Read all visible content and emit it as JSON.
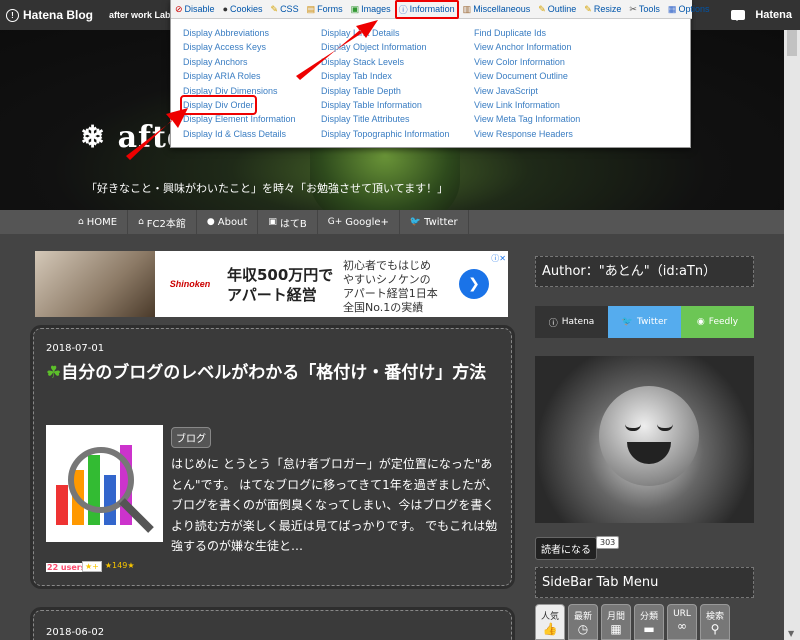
{
  "hatena_bar": {
    "logo": "Hatena Blog",
    "blog_name": "after work Labo",
    "right_logo": "Hatena"
  },
  "header": {
    "title": "after",
    "description": "「好きなこと・興味がわいたこと」を時々「お勉強させて頂いてます！」"
  },
  "nav": {
    "items": [
      {
        "icon": "home-icon",
        "label": "HOME"
      },
      {
        "icon": "bank-icon",
        "label": "FC2本館"
      },
      {
        "icon": "person-icon",
        "label": "About"
      },
      {
        "icon": "hatena-icon",
        "label": "はてB"
      },
      {
        "icon": "google-plus-icon",
        "label": "Google+"
      },
      {
        "icon": "twitter-icon",
        "label": "Twitter"
      }
    ]
  },
  "ad": {
    "logo": "Shinoken",
    "headline_line1": "年収500万円で",
    "headline_line2": "アパート経営",
    "text_line1": "初心者でもはじめ",
    "text_line2": "やすいシノケンの",
    "text_line3": "アパート経営1日本",
    "text_line4": "全国No.1の実績"
  },
  "post": {
    "date": "2018-07-01",
    "title": "自分のブログのレベルがわかる「格付け・番付け」方法",
    "category": "ブログ",
    "excerpt": "はじめに とうとう「怠け者ブロガー」が定位置になった\"あとん\"です。 はてなブログに移ってきて1年を過ぎましたが、 ブログを書くのが面倒臭くなってしまい、今はブログを書くより読む方が楽しく最近は見てばっかりです。 でもこれは勉強するのが嫌な生徒と…",
    "users": "22 users",
    "star_add": "★+",
    "stars": "★149★"
  },
  "post2": {
    "date": "2018-06-02"
  },
  "sidebar": {
    "author_title": "Author：\"あとん\"（id:aTn）",
    "share": [
      {
        "label": "Hatena",
        "color": "#333333"
      },
      {
        "label": "Twitter",
        "color": "#55acee"
      },
      {
        "label": "Feedly",
        "color": "#6cc655"
      }
    ],
    "reader_button": "読者になる",
    "reader_count": "303",
    "tab_menu_title": "SideBar Tab Menu",
    "tabs": [
      {
        "label": "人気",
        "icon": "thumbs-up-icon"
      },
      {
        "label": "最新",
        "icon": "clock-icon"
      },
      {
        "label": "月間",
        "icon": "calendar-icon"
      },
      {
        "label": "分類",
        "icon": "folder-icon"
      },
      {
        "label": "URL",
        "icon": "link-icon"
      },
      {
        "label": "検索",
        "icon": "search-icon"
      }
    ]
  },
  "toolbar": {
    "tabs": [
      {
        "label": "Disable",
        "icon": "disable-icon"
      },
      {
        "label": "Cookies",
        "icon": "cookies-icon"
      },
      {
        "label": "CSS",
        "icon": "css-icon"
      },
      {
        "label": "Forms",
        "icon": "forms-icon"
      },
      {
        "label": "Images",
        "icon": "images-icon"
      },
      {
        "label": "Information",
        "icon": "information-icon"
      },
      {
        "label": "Miscellaneous",
        "icon": "miscellaneous-icon"
      },
      {
        "label": "Outline",
        "icon": "outline-icon"
      },
      {
        "label": "Resize",
        "icon": "resize-icon"
      },
      {
        "label": "Tools",
        "icon": "tools-icon"
      },
      {
        "label": "Options",
        "icon": "options-icon"
      }
    ],
    "selected_tab": "Information",
    "columns": [
      [
        "Display Abbreviations",
        "Display Access Keys",
        "Display Anchors",
        "Display ARIA Roles",
        "Display Div Dimensions",
        "Display Div Order",
        "Display Element Information",
        "Display Id & Class Details"
      ],
      [
        "Display Link Details",
        "Display Object Information",
        "Display Stack Levels",
        "Display Tab Index",
        "Display Table Depth",
        "Display Table Information",
        "Display Title Attributes",
        "Display Topographic Information"
      ],
      [
        "Find Duplicate Ids",
        "View Anchor Information",
        "View Color Information",
        "View Document Outline",
        "View JavaScript",
        "View Link Information",
        "View Meta Tag Information",
        "View Response Headers"
      ]
    ],
    "highlighted_item": "Display Div Order",
    "accent": "#e00000"
  }
}
